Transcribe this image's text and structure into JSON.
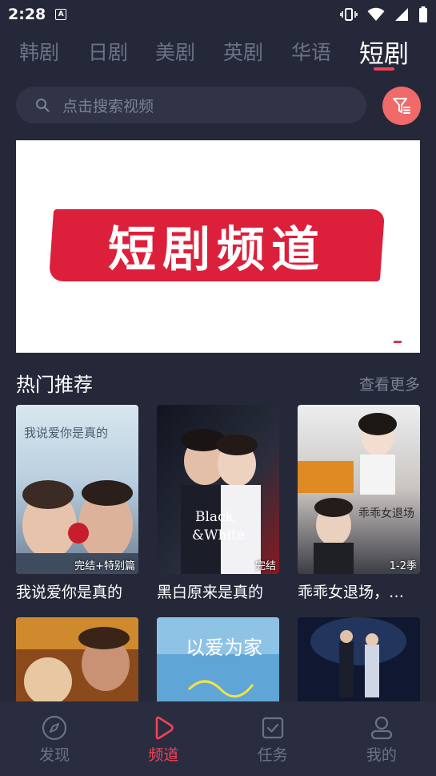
{
  "status_bar": {
    "time": "2:28",
    "notification_icon": "A"
  },
  "tabs": [
    {
      "label": "韩剧"
    },
    {
      "label": "日剧"
    },
    {
      "label": "美剧"
    },
    {
      "label": "英剧"
    },
    {
      "label": "华语"
    },
    {
      "label": "短剧"
    }
  ],
  "active_tab": 5,
  "search": {
    "placeholder": "点击搜索视频"
  },
  "banner": {
    "text": "短剧频道"
  },
  "section": {
    "title": "热门推荐",
    "more": "查看更多"
  },
  "cards": [
    {
      "title": "我说爱你是真的",
      "tag": "完结+特别篇"
    },
    {
      "title": "黑白原来是真的",
      "tag": "完结"
    },
    {
      "title": "乖乖女退场，…",
      "tag": "1-2季"
    },
    {
      "title": "",
      "tag": ""
    },
    {
      "title": "",
      "tag": ""
    },
    {
      "title": "",
      "tag": ""
    }
  ],
  "bottom_nav": [
    {
      "label": "发现",
      "icon": "compass-icon"
    },
    {
      "label": "频道",
      "icon": "play-icon"
    },
    {
      "label": "任务",
      "icon": "task-icon"
    },
    {
      "label": "我的",
      "icon": "user-icon"
    }
  ],
  "colors": {
    "accent": "#f0425a",
    "background": "#252838",
    "inactive": "#6c7286"
  }
}
